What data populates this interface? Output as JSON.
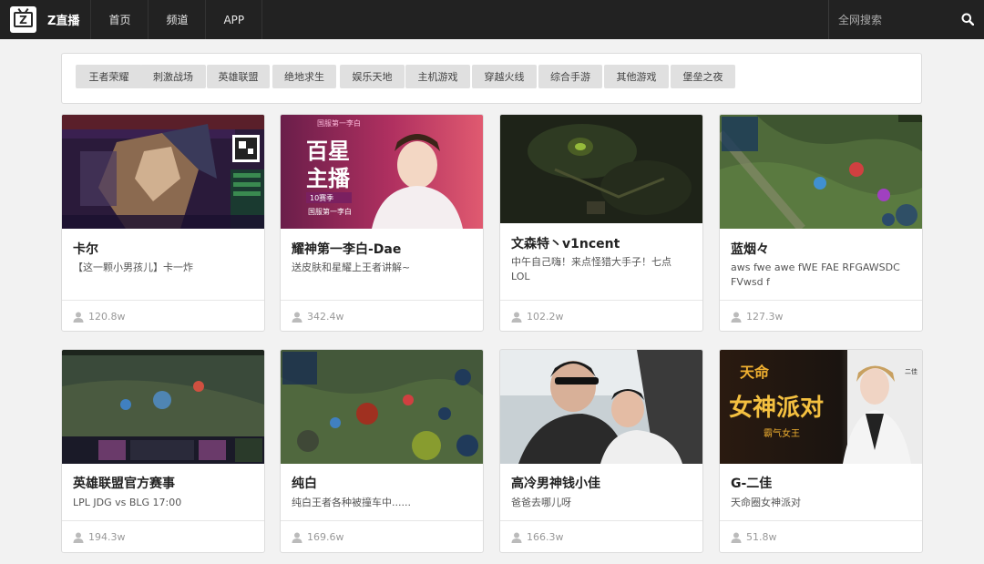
{
  "nav": {
    "brand": "Z直播",
    "logo_letter": "Z",
    "items": [
      "首页",
      "频道",
      "APP"
    ],
    "search_placeholder": "全网搜索"
  },
  "categories": [
    "王者荣耀",
    "刺激战场",
    "英雄联盟",
    "绝地求生",
    "娱乐天地",
    "主机游戏",
    "穿越火线",
    "综合手游",
    "其他游戏",
    "堡垒之夜"
  ],
  "cards": [
    {
      "title": "卡尔",
      "desc": "【这一颗小男孩儿】卡一炸",
      "views": "120.8w"
    },
    {
      "title": "耀神第一李白-Dae",
      "desc": "送皮肤和星耀上王者讲解~",
      "views": "342.4w"
    },
    {
      "title": "文森特丶v1ncent",
      "desc": "中午自己嗨！来点怪猎大手子！七点LOL",
      "views": "102.2w"
    },
    {
      "title": "蓝烟々",
      "desc": "aws fwe awe fWE FAE RFGAWSDC FVwsd f",
      "views": "127.3w"
    },
    {
      "title": "英雄联盟官方赛事",
      "desc": "LPL JDG vs BLG 17:00",
      "views": "194.3w"
    },
    {
      "title": "纯白",
      "desc": "纯白王者各种被撞车中......",
      "views": "169.6w"
    },
    {
      "title": "高冷男神钱小佳",
      "desc": "爸爸去哪儿呀",
      "views": "166.3w"
    },
    {
      "title": "G-二佳",
      "desc": "天命圈女神派对",
      "views": "51.8w"
    }
  ],
  "thumb_text": {
    "c2_big1": "百星",
    "c2_big2": "主播",
    "c2_top": "国服第一李白",
    "c2_small1": "10赛季",
    "c2_small2": "国服第一李白",
    "c8_big1": "天命",
    "c8_big2": "女神派对",
    "c8_small": "霸气女王",
    "c8_side": "二佳"
  },
  "colors": {
    "navbar": "#222222",
    "page_bg": "#f2f2f2",
    "chip_bg": "#e0e0e0"
  }
}
